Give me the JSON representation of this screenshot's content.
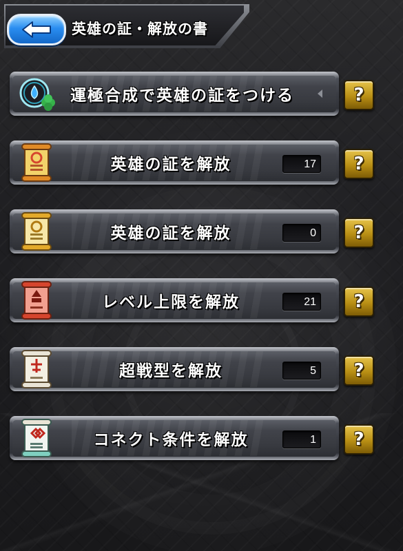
{
  "header": {
    "title": "英雄の証・解放の書",
    "back_icon": "back-arrow-icon",
    "back_color": "#2a8df0"
  },
  "rows": [
    {
      "label": "運極合成で英雄の証をつける",
      "icon": "heart-clover-icon",
      "count": null,
      "help": "?"
    },
    {
      "label": "英雄の証を解放",
      "icon": "hero-scroll-red-icon",
      "count": "17",
      "help": "?"
    },
    {
      "label": "英雄の証を解放",
      "icon": "hero-scroll-gold-icon",
      "count": "0",
      "help": "?"
    },
    {
      "label": "レベル上限を解放",
      "icon": "level-scroll-red-icon",
      "count": "21",
      "help": "?"
    },
    {
      "label": "超戦型を解放",
      "icon": "super-battle-scroll-icon",
      "count": "5",
      "help": "?"
    },
    {
      "label": "コネクト条件を解放",
      "icon": "connect-scroll-icon",
      "count": "1",
      "help": "?"
    }
  ],
  "colors": {
    "help_button": "#b98f14",
    "scroll_red": "#d6452e",
    "scroll_gold": "#e3a92a",
    "scroll_pale": "#e9e4d6",
    "scroll_teal": "#7fd0c0"
  }
}
